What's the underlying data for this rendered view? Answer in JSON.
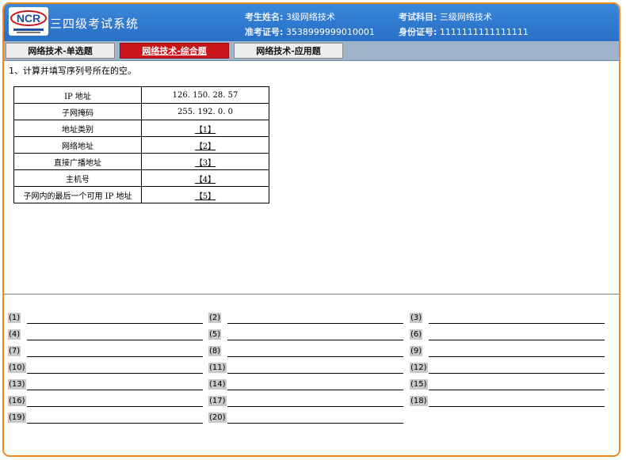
{
  "header": {
    "logo_text": "NCR",
    "system_title": "三四级考试系统",
    "candidate_name_label": "考生姓名:",
    "candidate_name": "3级网络技术",
    "exam_subject_label": "考试科目:",
    "exam_subject": "三级网络技术",
    "ticket_label": "准考证号:",
    "ticket_number": "3538999999010001",
    "id_label": "身份证号:",
    "id_number": "1111111111111111"
  },
  "tabs": [
    {
      "label": "网络技术-单选题",
      "active": false
    },
    {
      "label": "网络技术-综合题",
      "active": true
    },
    {
      "label": "网络技术-应用题",
      "active": false
    }
  ],
  "question": {
    "text": "1、计算并填写序列号所在的空。",
    "rows": [
      {
        "label": "IP 地址",
        "value": "126. 150. 28. 57"
      },
      {
        "label": "子网掩码",
        "value": "255. 192. 0. 0"
      },
      {
        "label": "地址类别",
        "value": "【1】"
      },
      {
        "label": "网络地址",
        "value": "【2】"
      },
      {
        "label": "直接广播地址",
        "value": "【3】"
      },
      {
        "label": "主机号",
        "value": "【4】"
      },
      {
        "label": "子网内的最后一个可用 IP 地址",
        "value": "【5】"
      }
    ]
  },
  "answers": [
    "(1)",
    "(2)",
    "(3)",
    "(4)",
    "(5)",
    "(6)",
    "(7)",
    "(8)",
    "(9)",
    "(10)",
    "(11)",
    "(12)",
    "(13)",
    "(14)",
    "(15)",
    "(16)",
    "(17)",
    "(18)",
    "(19)",
    "(20)"
  ],
  "colors": {
    "frame": "#f08a1e",
    "header": "#2f79cf",
    "active_tab": "#c8161b"
  }
}
